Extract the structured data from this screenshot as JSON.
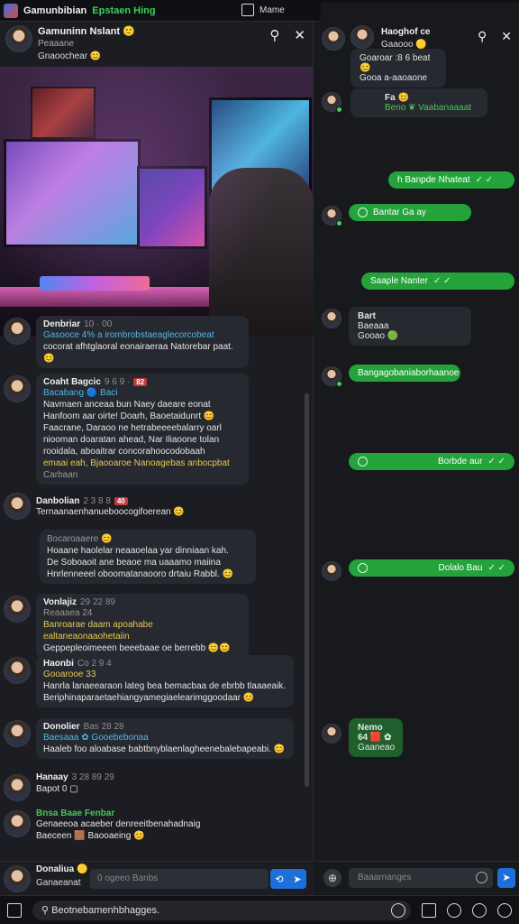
{
  "topbar": {
    "app_title": "Gamunbibian",
    "app_sub": "Epstaen Hing",
    "mid_label": "Mame",
    "buttons": [
      {
        "icon": "gear-icon",
        "color": "#17191d"
      },
      {
        "icon": "globe-icon",
        "color": "#17191d"
      },
      {
        "icon": "pin-icon",
        "color": "#17191d"
      },
      {
        "icon": "folder-icon",
        "color": "#2b6bd6"
      },
      {
        "icon": "shield-icon",
        "color": "#1e6fd9"
      },
      {
        "icon": "alert-icon",
        "color": "#c23a3a"
      },
      {
        "icon": "mic-icon",
        "color": "#17191d"
      },
      {
        "icon": "avatar-icon",
        "color": "#17191d"
      }
    ]
  },
  "left": {
    "header": {
      "name": "Gamuninn Nslant 🙂",
      "meta": "Peaaane",
      "status": "Gnaoochear 😊"
    },
    "messages": [
      {
        "name": "Denbriar",
        "time": "10 · 00",
        "lines": [
          "Gasooce  4% a irombrobstaeaglecorcobeat",
          "cocorat afhtglaoral eonairaeraa Natorebar paat. 😊"
        ]
      },
      {
        "name": "Coaht Bagcic",
        "time": "9 6 9 ·",
        "badge": "82",
        "lines": [
          "Bacabang 🔵 Baci",
          "Navmaen anceaa bun   Naey daeare eonat",
          "Hanfoom aar oirte! Doarh, Baoetaidunrt 😊",
          "Faacrane, Daraoo ne hetrabeeeebalarry oarl",
          "niooman doaratan ahead,  Nar  Iliaoone  tolan",
          "rooidala, aboaitrar concorahoocodobaah",
          "emaai eah, Bjaooaroe  Nanoagebas  anbocpbat",
          "Carbaan"
        ]
      },
      {
        "name": "Danbolian",
        "time": "2 3 8 8",
        "badge": "40",
        "lines": [
          "Ternaanaenhanueboocogifoerean 😊"
        ]
      },
      {
        "name": "",
        "time": "",
        "lines": [
          "Bocaroaaere 😊",
          "Hoaane haolelar neaaoelaa yar dinniaan kah.",
          "De Soboaoit ane beaoe ma uaaamo maiina",
          "Hnrlenneeel oboomatanaooro drtaiu Rabbl. 😊"
        ]
      },
      {
        "name": "Vonlajiz",
        "time": "29 22 89",
        "lines": [
          "Reaaaea 24",
          "Banroarae  daam apoahabe  ealtaneaonaaohetaiin",
          "Geppepleoimeeen beeebaae oe berrebb 😊😊"
        ]
      },
      {
        "name": "Haonbi",
        "time": "Co 2 9 4",
        "lines": [
          "Gooarooe    33",
          "Hanrla  lanaeearaon lateg bea  bemacbaa de ebrbb tlaaaeaik.",
          "Beriphinaparaetaehiangyamegiaelearimggoodaar 😊"
        ]
      },
      {
        "name": "Donolier",
        "time": "Bas 28 28",
        "lines": [
          "Baesaaa  ✿  Gooebebonaa",
          "Haaleb foo aloabase babtbnyblaenlagheenebalebapeabi. 😊"
        ]
      },
      {
        "name": "Hanaay",
        "time": "3 28 89 29",
        "lines": [
          "Bapot   0 ▢"
        ]
      },
      {
        "name": "Bnsa Baae  Fenbar",
        "time": "",
        "lines": [
          "Genaeeoa acaeber denreeitbenahadnaig",
          "Baeceen  🟫  Baooaeing 😊"
        ]
      }
    ],
    "composer": {
      "name": "Donaliua 🟡",
      "sub": "Ganaeanat",
      "placeholder": "0 ogeeo Banbs"
    }
  },
  "right": {
    "header": {
      "name": "Haoghof ce",
      "sub": "Gaaooo 🟡"
    },
    "incoming": [
      {
        "lines": [
          "Goaroar :8 6 beat 😊",
          "Gooa a-aaoaone"
        ]
      },
      {
        "lines": [
          "Fa 😊",
          "Beno  ❦  Vaabanaaaat"
        ]
      },
      {
        "lines": [
          "Bart",
          "Baeaaa",
          "Gooao 🟢"
        ]
      },
      {
        "lines": [
          "Bangagobaniaborhaanoe"
        ]
      },
      {
        "lines": [
          "Nemo 64  🟥 ✿",
          "Gaaneao"
        ]
      }
    ],
    "outgoing": [
      {
        "text": "h Banpde Nhateat",
        "ticks": "✓ ✓"
      },
      {
        "text": "Bantar Ga ay",
        "ticks": ""
      },
      {
        "text": "Saaple Nanter",
        "ticks": "✓ ✓"
      },
      {
        "text": "Borbde aur",
        "ticks": "✓ ✓"
      },
      {
        "text": "Dolalo Bau",
        "ticks": "✓ ✓"
      }
    ],
    "composer": {
      "placeholder": "Baaarnanges"
    }
  },
  "bottombar": {
    "search_placeholder": "Beotnebamenhbhagges."
  }
}
